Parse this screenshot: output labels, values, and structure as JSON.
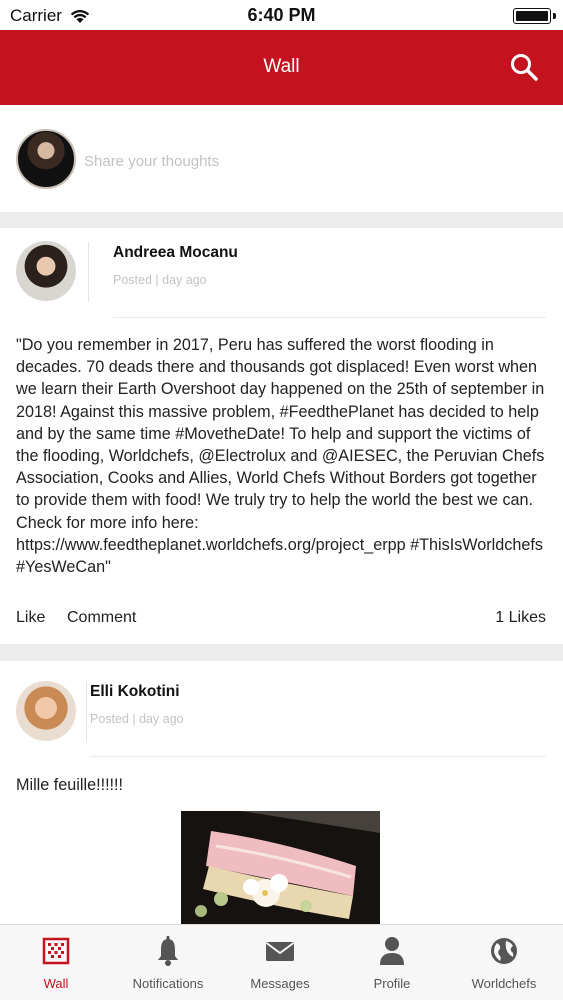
{
  "status_bar": {
    "carrier": "Carrier",
    "time": "6:40 PM"
  },
  "header": {
    "title": "Wall"
  },
  "composer": {
    "placeholder": "Share your thoughts"
  },
  "posts": [
    {
      "author": "Andreea Mocanu",
      "meta": "Posted  |  day ago",
      "text": "\"Do you remember in 2017, Peru has suffered the worst flooding in decades. 70 deads there and thousands got displaced! Even worst when we learn their Earth Overshoot day happened on the 25th of september in 2018! Against this massive problem, #FeedthePlanet has decided to help and by the same time #MovetheDate! To help and support the victims of the flooding, Worldchefs, @Electrolux and @AIESEC, the Peruvian Chefs Association, Cooks and Allies, World Chefs Without Borders got together to provide them with food! We truly try to help the world the best we can. Check for more info here: https://www.feedtheplanet.worldchefs.org/project_erpp #ThisIsWorldchefs #YesWeCan\"",
      "like_label": "Like",
      "comment_label": "Comment",
      "likes_count": "1 Likes"
    },
    {
      "author": "Elli Kokotini",
      "meta": "Posted  |  day ago",
      "text": "Mille feuille!!!!!!"
    }
  ],
  "tabs": [
    {
      "label": "Wall",
      "icon": "wall-grid-icon",
      "active": true
    },
    {
      "label": "Notifications",
      "icon": "bell-icon",
      "active": false
    },
    {
      "label": "Messages",
      "icon": "envelope-icon",
      "active": false
    },
    {
      "label": "Profile",
      "icon": "person-icon",
      "active": false
    },
    {
      "label": "Worldchefs",
      "icon": "globe-icon",
      "active": false
    }
  ],
  "colors": {
    "brand_red": "#c4121f",
    "tab_inactive": "#555555",
    "divider": "#ececec"
  }
}
